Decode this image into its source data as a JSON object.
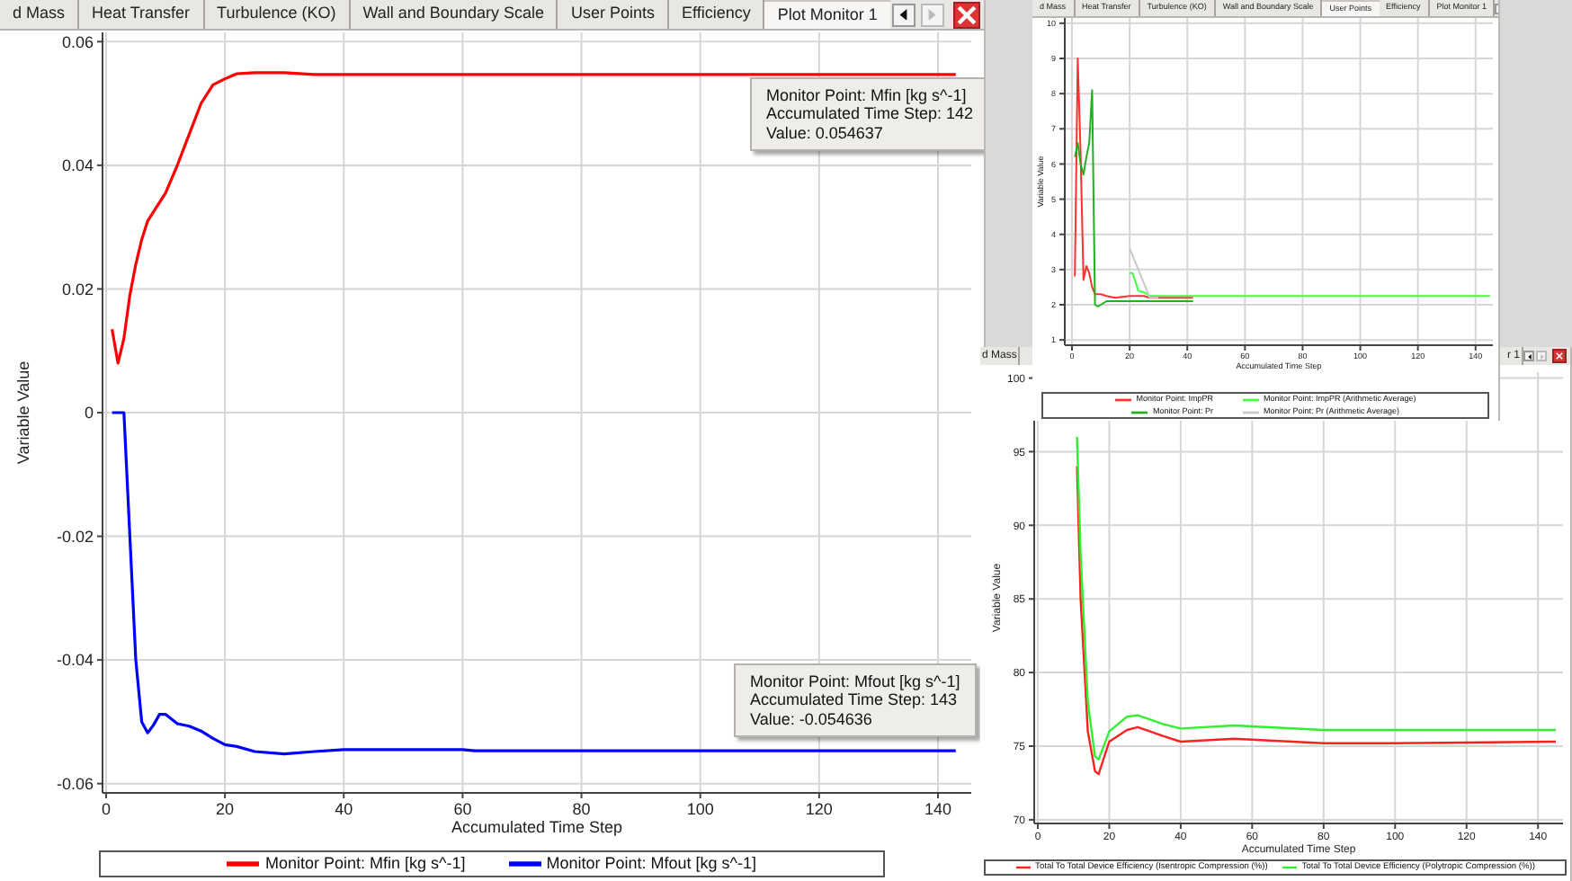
{
  "windows": [
    {
      "tabs": [
        {
          "label": "d Mass",
          "selected": false
        },
        {
          "label": "Heat Transfer",
          "selected": false
        },
        {
          "label": "Turbulence (KO)",
          "selected": false
        },
        {
          "label": "Wall and Boundary Scale",
          "selected": false
        },
        {
          "label": "User Points",
          "selected": false
        },
        {
          "label": "Efficiency",
          "selected": false
        },
        {
          "label": "Plot Monitor 1",
          "selected": true
        }
      ],
      "chart_data": {
        "type": "line",
        "grid": true,
        "xlabel": "Accumulated Time Step",
        "ylabel": "Variable Value",
        "xlim": [
          -0.6,
          145.6
        ],
        "ylim": [
          -0.0615,
          0.0615
        ],
        "xticks": [
          0,
          20,
          40,
          60,
          80,
          100,
          120,
          140
        ],
        "yticks": [
          -0.06,
          -0.04,
          -0.02,
          0,
          0.02,
          0.04,
          0.06
        ],
        "x": [
          1,
          2,
          3,
          4,
          5,
          6,
          7,
          8,
          9,
          10,
          12,
          14,
          16,
          18,
          20,
          22,
          25,
          30,
          35,
          40,
          60,
          62,
          100,
          143
        ],
        "series": [
          {
            "name": "Monitor Point: Mfin [kg s^-1]",
            "color": "#ff0000",
            "values": [
              0.0135,
              0.008,
              0.012,
              0.019,
              0.024,
              0.028,
              0.031,
              0.0325,
              0.034,
              0.0355,
              0.04,
              0.045,
              0.05,
              0.053,
              0.054,
              0.0548,
              0.055,
              0.055,
              0.0547,
              0.0547,
              0.0547,
              0.0547,
              0.0547,
              0.0547
            ]
          },
          {
            "name": "Monitor Point: Mfout [kg s^-1]",
            "color": "#0000ff",
            "values": [
              0,
              0,
              0,
              -0.02,
              -0.04,
              -0.05,
              -0.0518,
              -0.0505,
              -0.0488,
              -0.0488,
              -0.0503,
              -0.0507,
              -0.0515,
              -0.0527,
              -0.0537,
              -0.054,
              -0.0548,
              -0.0552,
              -0.0548,
              -0.0545,
              -0.0545,
              -0.0547,
              -0.0547,
              -0.0547
            ]
          }
        ]
      },
      "tooltips": [
        {
          "lines": [
            "Monitor Point: Mfin [kg s^-1]",
            "Accumulated Time Step: 142",
            "Value: 0.054637"
          ]
        },
        {
          "lines": [
            "Monitor Point: Mfout [kg s^-1]",
            "Accumulated Time Step: 143",
            "Value: -0.054636"
          ]
        }
      ]
    },
    {
      "tabs": [
        {
          "label": "d Mass",
          "selected": false
        },
        {
          "label": "r 1",
          "selected": false
        }
      ],
      "chart_data": {
        "type": "line",
        "grid": true,
        "xlabel": "Accumulated Time Step",
        "ylabel": "Variable Value",
        "xlim": [
          -1,
          147
        ],
        "ylim": [
          69.75,
          100.4
        ],
        "xticks": [
          0,
          20,
          40,
          60,
          80,
          100,
          120,
          140
        ],
        "yticks": [
          70,
          75,
          80,
          85,
          90,
          95,
          100
        ],
        "x": [
          11,
          12,
          14,
          16,
          17,
          20,
          25,
          28,
          35,
          40,
          55,
          80,
          100,
          145
        ],
        "series": [
          {
            "name": "Total To Total Device Efficiency (Isentropic Compression (%))",
            "color": "#ff2020",
            "values": [
              94,
              85,
              76,
              73.3,
              73.1,
              75.3,
              76.1,
              76.3,
              75.7,
              75.3,
              75.5,
              75.2,
              75.2,
              75.3
            ]
          },
          {
            "name": "Total To Total Device Efficiency (Polytropic Compression (%))",
            "color": "#30f030",
            "values": [
              96,
              88,
              78,
              74.3,
              74.1,
              76.0,
              77.0,
              77.1,
              76.5,
              76.2,
              76.4,
              76.1,
              76.1,
              76.1
            ]
          }
        ]
      }
    },
    {
      "tabs": [
        {
          "label": "d Mass",
          "selected": false
        },
        {
          "label": "Heat Transfer",
          "selected": false
        },
        {
          "label": "Turbulence (KO)",
          "selected": false
        },
        {
          "label": "Wall and Boundary Scale",
          "selected": false
        },
        {
          "label": "User Points",
          "selected": true
        },
        {
          "label": "Efficiency",
          "selected": false
        },
        {
          "label": "Plot Monitor 1",
          "selected": false
        }
      ],
      "chart_data": {
        "type": "line",
        "grid": true,
        "xlabel": "Accumulated Time Step",
        "ylabel": "Variable Value",
        "xlim": [
          -2.5,
          146
        ],
        "ylim": [
          0.85,
          10.15
        ],
        "xticks": [
          0,
          20,
          40,
          60,
          80,
          100,
          120,
          140
        ],
        "yticks": [
          1,
          2,
          3,
          4,
          5,
          6,
          7,
          8,
          9,
          10
        ],
        "x": [
          1,
          2,
          3,
          4,
          5,
          6,
          7,
          8,
          9,
          10,
          12,
          15,
          20,
          21,
          23,
          25,
          27,
          30,
          42,
          145
        ],
        "series": [
          {
            "name": "Monitor Point: ImpPR",
            "color": "#ff3030",
            "values": [
              2.8,
              9.0,
              6.3,
              2.7,
              3.1,
              2.9,
              2.5,
              2.3,
              2.3,
              2.3,
              2.25,
              2.2,
              2.25,
              2.25,
              2.25,
              2.25,
              2.2,
              2.2,
              2.2,
              null
            ]
          },
          {
            "name": "Monitor Point: ImpPR (Arithmetic Average)",
            "color": "#40ff40",
            "values": [
              null,
              null,
              null,
              null,
              null,
              null,
              null,
              null,
              null,
              null,
              null,
              null,
              2.9,
              2.9,
              2.4,
              2.35,
              2.25,
              2.25,
              2.25,
              2.25
            ]
          },
          {
            "name": "Monitor Point: Pr",
            "color": "#20b020",
            "values": [
              6.2,
              6.6,
              6.0,
              5.7,
              6.2,
              6.6,
              8.1,
              2.0,
              1.95,
              2.0,
              2.1,
              2.1,
              2.1,
              2.1,
              2.1,
              2.1,
              2.1,
              2.1,
              2.1,
              null
            ]
          },
          {
            "name": "Monitor Point: Pr (Arithmetic Average)",
            "color": "#c8c8c8",
            "values": [
              null,
              null,
              null,
              null,
              null,
              null,
              null,
              null,
              null,
              null,
              null,
              null,
              3.6,
              3.4,
              3.0,
              2.6,
              2.2,
              2.2,
              null,
              null
            ]
          }
        ]
      }
    }
  ]
}
